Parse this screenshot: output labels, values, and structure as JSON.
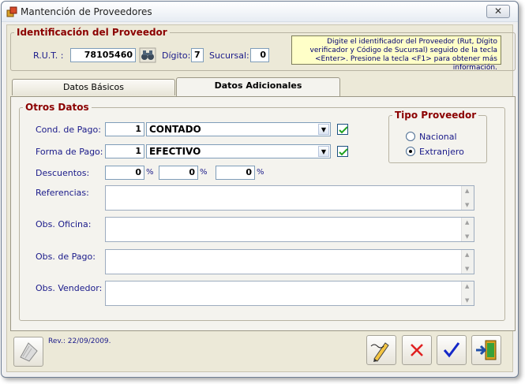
{
  "window": {
    "title": "Mantención de Proveedores",
    "close_label": "✕"
  },
  "identification": {
    "legend": "Identificación del Proveedor",
    "rut_label": "R.U.T. :",
    "rut_value": "78105460",
    "digit_label": "Dígito:",
    "digit_value": "7",
    "branch_label": "Sucursal:",
    "branch_value": "0",
    "hint_text": "Digite el identificador del Proveedor (Rut, Dígito verificador y Código de Sucursal) seguido de la tecla <Enter>. Presione la tecla <F1> para obtener más información."
  },
  "tabs": [
    {
      "label": "Datos Básicos",
      "active": false
    },
    {
      "label": "Datos Adicionales",
      "active": true
    }
  ],
  "other_data": {
    "legend": "Otros Datos",
    "payment_condition": {
      "label": "Cond. de Pago:",
      "code": "1",
      "value": "CONTADO",
      "checked": true
    },
    "payment_method": {
      "label": "Forma de Pago:",
      "code": "1",
      "value": "EFECTIVO",
      "checked": true
    },
    "discounts": {
      "label": "Descuentos:",
      "values": [
        "0",
        "0",
        "0"
      ],
      "unit": "%"
    },
    "references": {
      "label": "Referencias:",
      "value": ""
    },
    "office_notes": {
      "label": "Obs. Oficina:",
      "value": ""
    },
    "payment_notes": {
      "label": "Obs. de Pago:",
      "value": ""
    },
    "seller_notes": {
      "label": "Obs. Vendedor:",
      "value": ""
    }
  },
  "supplier_type": {
    "legend": "Tipo Proveedor",
    "options": [
      {
        "label": "Nacional",
        "selected": false
      },
      {
        "label": "Extranjero",
        "selected": true
      }
    ]
  },
  "footer": {
    "revision": "Rev.: 22/09/2009."
  },
  "colors": {
    "label_blue": "#1a1a8a",
    "legend_red": "#8b0000",
    "hint_bg": "#ffffc8"
  },
  "icons": [
    "app-icon",
    "binoculars-icon",
    "checkmark-icon",
    "notepad-icon",
    "edit-pencil-icon",
    "delete-x-icon",
    "confirm-check-icon",
    "exit-door-icon"
  ]
}
